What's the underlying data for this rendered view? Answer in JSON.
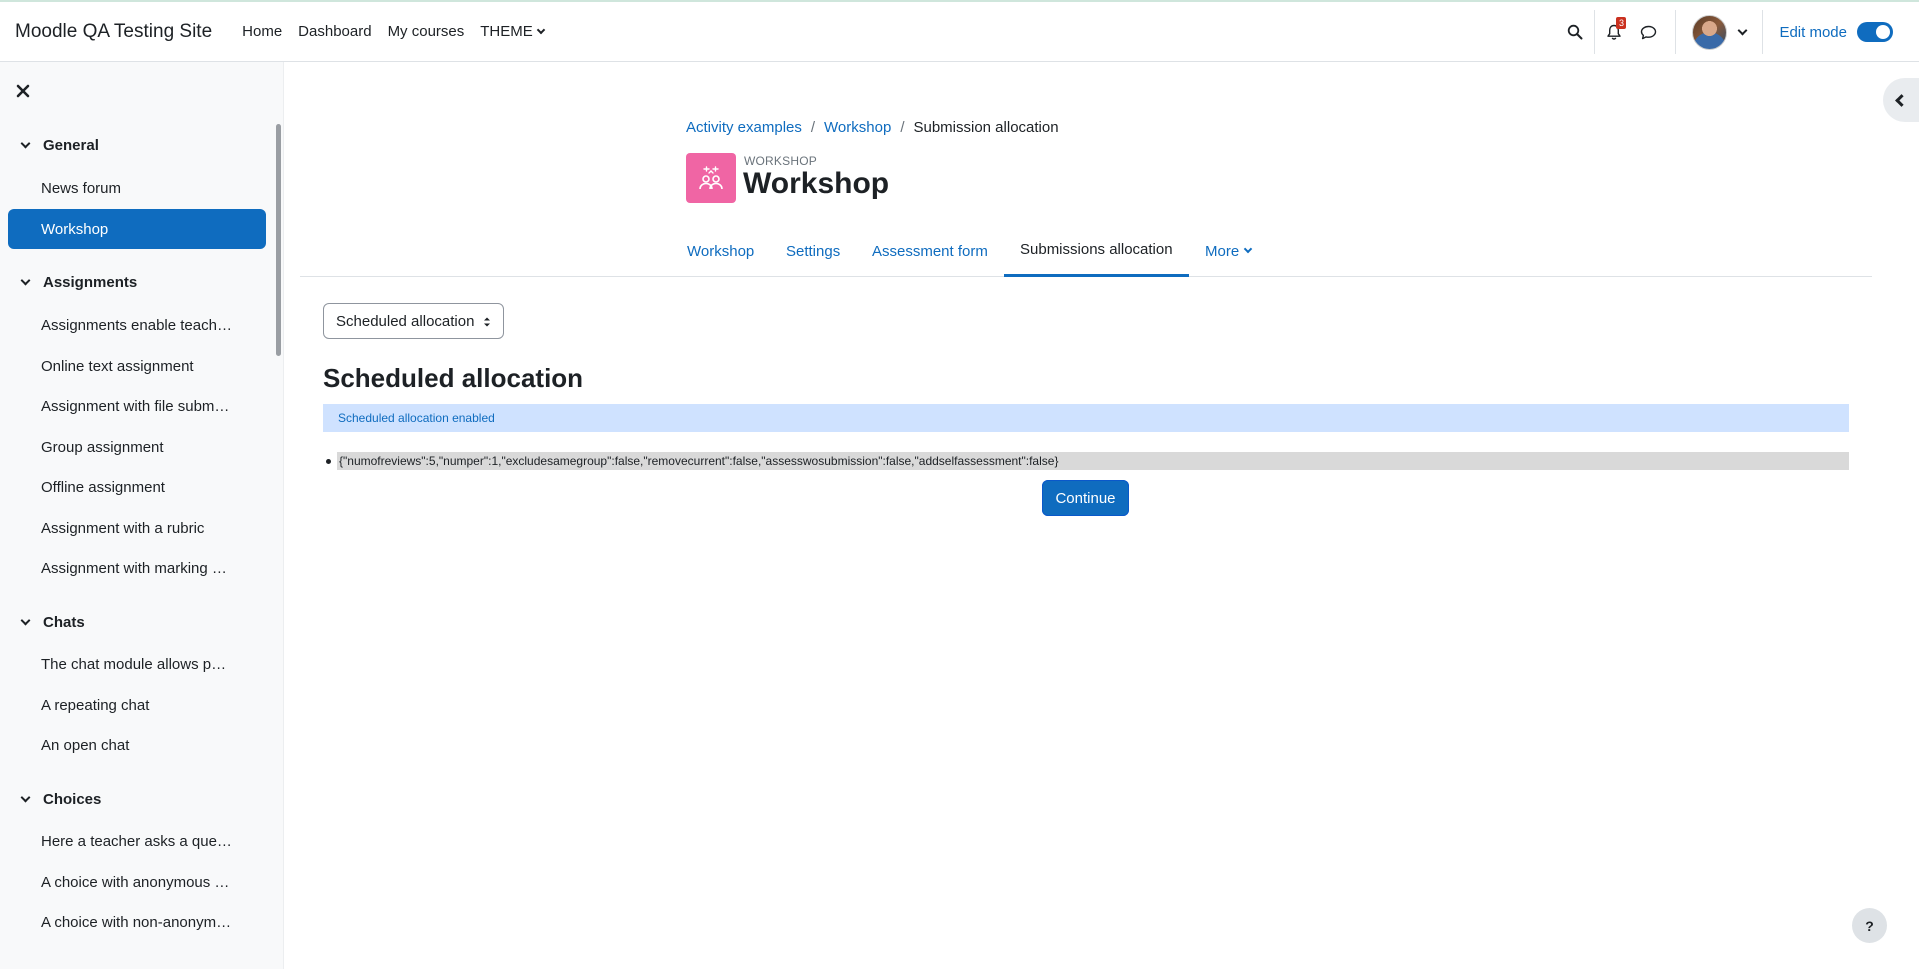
{
  "navbar": {
    "brand": "Moodle QA Testing Site",
    "links": [
      "Home",
      "Dashboard",
      "My courses",
      "THEME"
    ],
    "notification_count": "3",
    "edit_mode_label": "Edit mode"
  },
  "drawer": {
    "sections": [
      {
        "title": "General",
        "items": [
          "News forum",
          "Workshop"
        ]
      },
      {
        "title": "Assignments",
        "items": [
          "Assignments enable teach…",
          "Online text assignment",
          "Assignment with file subm…",
          "Group assignment",
          "Offline assignment",
          "Assignment with a rubric",
          "Assignment with marking …"
        ]
      },
      {
        "title": "Chats",
        "items": [
          "The chat module allows p…",
          "A repeating chat",
          "An open chat"
        ]
      },
      {
        "title": "Choices",
        "items": [
          "Here a teacher asks a que…",
          "A choice with anonymous …",
          "A choice with non-anonym…"
        ]
      }
    ],
    "active_item": "Workshop"
  },
  "breadcrumb": [
    "Activity examples",
    "Workshop",
    "Submission allocation"
  ],
  "header": {
    "pre_title": "WORKSHOP",
    "title": "Workshop"
  },
  "tabs": [
    "Workshop",
    "Settings",
    "Assessment form",
    "Submissions allocation",
    "More"
  ],
  "active_tab": "Submissions allocation",
  "allocator_select": "Scheduled allocation",
  "content": {
    "heading": "Scheduled allocation",
    "alert": "Scheduled allocation enabled",
    "json_settings": "{\"numofreviews\":5,\"numper\":1,\"excludesamegroup\":false,\"removecurrent\":false,\"assesswosubmission\":false,\"addselfassessment\":false}",
    "continue_button": "Continue"
  },
  "help_label": "?",
  "colors": {
    "primary": "#0f6cbf",
    "workshop_icon_bg": "#f065a4",
    "alert_bg": "#cfe2ff",
    "badge": "#ca3120"
  }
}
